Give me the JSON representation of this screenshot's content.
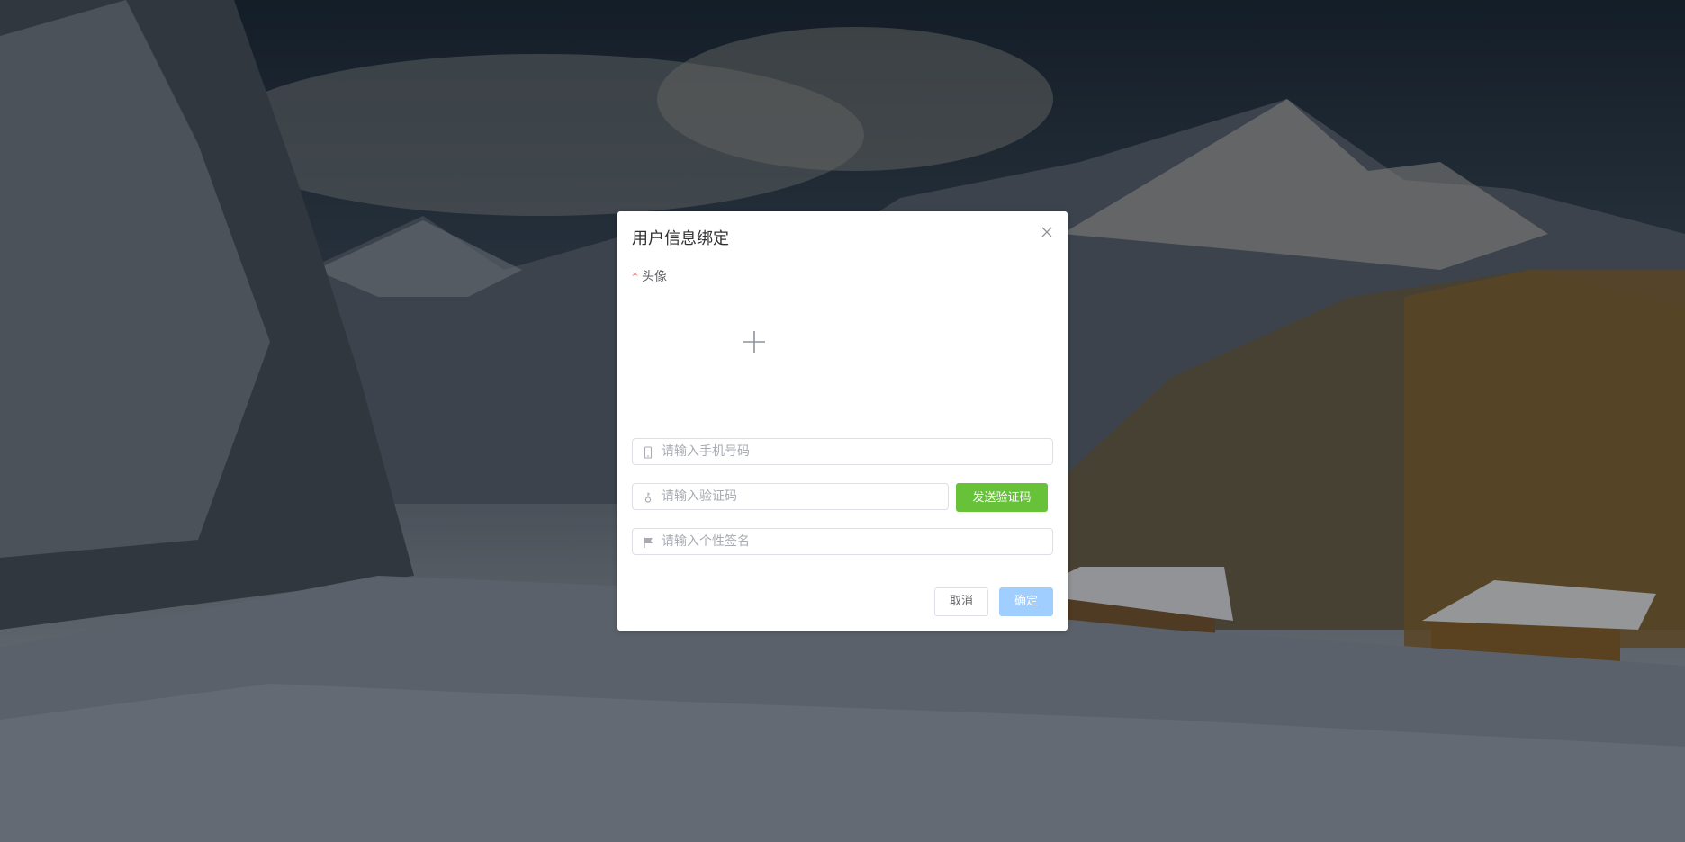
{
  "dialog": {
    "title": "用户信息绑定",
    "close_icon": "close-icon"
  },
  "form": {
    "avatar_label": "头像",
    "avatar_required_mark": "*",
    "upload_icon": "plus-icon",
    "phone": {
      "value": "",
      "placeholder": "请输入手机号码",
      "icon": "mobile-phone-icon"
    },
    "code": {
      "value": "",
      "placeholder": "请输入验证码",
      "icon": "key-icon"
    },
    "signature": {
      "value": "",
      "placeholder": "请输入个性签名",
      "icon": "flag-icon"
    },
    "send_code_label": "发送验证码"
  },
  "footer": {
    "cancel_label": "取消",
    "confirm_label": "确定"
  },
  "colors": {
    "send_button": "#67c23a",
    "confirm_button_disabled": "#a0cfff",
    "required_mark": "#f56c6c"
  }
}
